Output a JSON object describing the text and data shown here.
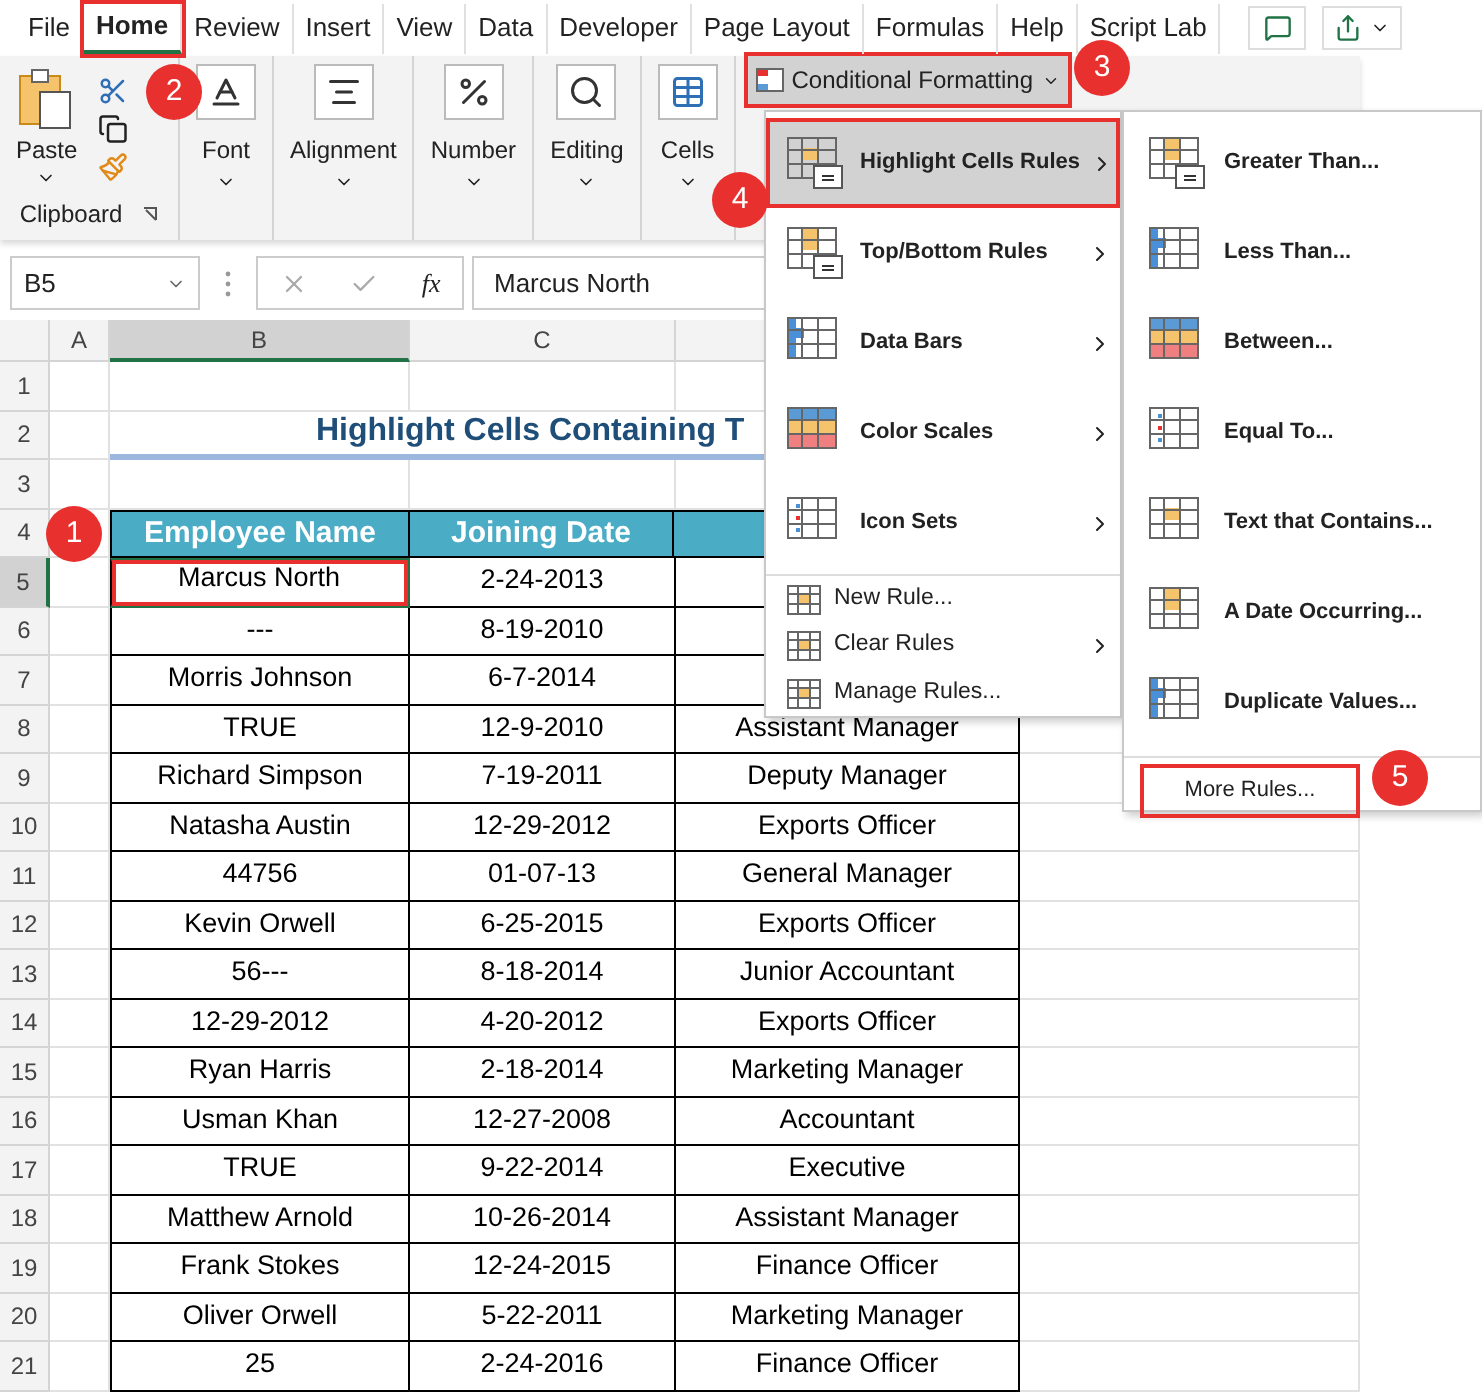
{
  "tabs": [
    {
      "label": "File",
      "selected": false,
      "outlined": false
    },
    {
      "label": "Home",
      "selected": true,
      "outlined": true
    },
    {
      "label": "Review",
      "selected": false,
      "outlined": false
    },
    {
      "label": "Insert",
      "selected": false,
      "outlined": false
    },
    {
      "label": "View",
      "selected": false,
      "outlined": false
    },
    {
      "label": "Data",
      "selected": false,
      "outlined": false
    },
    {
      "label": "Developer",
      "selected": false,
      "outlined": false
    },
    {
      "label": "Page Layout",
      "selected": false,
      "outlined": false
    },
    {
      "label": "Formulas",
      "selected": false,
      "outlined": false
    },
    {
      "label": "Help",
      "selected": false,
      "outlined": false
    },
    {
      "label": "Script Lab",
      "selected": false,
      "outlined": false
    }
  ],
  "ribbon": {
    "clipboard": {
      "paste": "Paste",
      "label": "Clipboard"
    },
    "groups": [
      {
        "label": "Font",
        "kind": "font"
      },
      {
        "label": "Alignment",
        "kind": "alignment"
      },
      {
        "label": "Number",
        "kind": "number"
      },
      {
        "label": "Editing",
        "kind": "editing"
      },
      {
        "label": "Cells",
        "kind": "cells"
      }
    ],
    "conditional_formatting": {
      "label": "Conditional Formatting",
      "outlined": true
    }
  },
  "formula_bar": {
    "name_box": "B5",
    "function_label": "fx",
    "value": "Marcus North"
  },
  "column_headers": [
    "A",
    "B",
    "C"
  ],
  "row_numbers": [
    "1",
    "2",
    "3",
    "4",
    "5",
    "6",
    "7",
    "8",
    "9",
    "10",
    "11",
    "12",
    "13",
    "14",
    "15",
    "16",
    "17",
    "18",
    "19",
    "20",
    "21"
  ],
  "title": "Highlight Cells Containing T",
  "table": {
    "columns": [
      "Employee Name",
      "Joining Date"
    ],
    "rows": [
      {
        "cells": [
          "Marcus North",
          "2-24-2013"
        ],
        "selected": true,
        "outlined": true
      },
      {
        "cells": [
          "---",
          "8-19-2010"
        ],
        "selected": false,
        "outlined": false
      },
      {
        "cells": [
          "Morris Johnson",
          "6-7-2014"
        ],
        "selected": false,
        "outlined": false
      },
      {
        "cells": [
          "TRUE",
          "12-9-2010",
          "Assistant Manager"
        ],
        "selected": false,
        "outlined": false
      },
      {
        "cells": [
          "Richard Simpson",
          "7-19-2011",
          "Deputy Manager"
        ],
        "selected": false,
        "outlined": false
      },
      {
        "cells": [
          "Natasha Austin",
          "12-29-2012",
          "Exports Officer"
        ],
        "selected": false,
        "outlined": false
      },
      {
        "cells": [
          "44756",
          "01-07-13",
          "General Manager"
        ],
        "selected": false,
        "outlined": false
      },
      {
        "cells": [
          "Kevin Orwell",
          "6-25-2015",
          "Exports Officer"
        ],
        "selected": false,
        "outlined": false
      },
      {
        "cells": [
          "56---",
          "8-18-2014",
          "Junior Accountant"
        ],
        "selected": false,
        "outlined": false
      },
      {
        "cells": [
          "12-29-2012",
          "4-20-2012",
          "Exports Officer"
        ],
        "selected": false,
        "outlined": false
      },
      {
        "cells": [
          "Ryan Harris",
          "2-18-2014",
          "Marketing Manager"
        ],
        "selected": false,
        "outlined": false
      },
      {
        "cells": [
          "Usman Khan",
          "12-27-2008",
          "Accountant"
        ],
        "selected": false,
        "outlined": false
      },
      {
        "cells": [
          "TRUE",
          "9-22-2014",
          "Executive"
        ],
        "selected": false,
        "outlined": false
      },
      {
        "cells": [
          "Matthew Arnold",
          "10-26-2014",
          "Assistant Manager"
        ],
        "selected": false,
        "outlined": false
      },
      {
        "cells": [
          "Frank Stokes",
          "12-24-2015",
          "Finance Officer"
        ],
        "selected": false,
        "outlined": false
      },
      {
        "cells": [
          "Oliver Orwell",
          "5-22-2011",
          "Marketing Manager"
        ],
        "selected": false,
        "outlined": false
      },
      {
        "cells": [
          "25",
          "2-24-2016",
          "Finance Officer"
        ],
        "selected": false,
        "outlined": false
      }
    ]
  },
  "menu": {
    "items": [
      {
        "label": "Highlight Cells Rules",
        "kind": "large",
        "submenu": true,
        "selected": true,
        "outlined": true
      },
      {
        "label": "Top/Bottom Rules",
        "kind": "large",
        "submenu": true,
        "selected": false,
        "outlined": false
      },
      {
        "label": "Data Bars",
        "kind": "large",
        "submenu": true,
        "selected": false,
        "outlined": false
      },
      {
        "label": "Color Scales",
        "kind": "large",
        "submenu": true,
        "selected": false,
        "outlined": false
      },
      {
        "label": "Icon Sets",
        "kind": "large",
        "submenu": true,
        "selected": false,
        "outlined": false
      },
      {
        "label": "New Rule...",
        "kind": "small",
        "submenu": false,
        "selected": false,
        "outlined": false
      },
      {
        "label": "Clear Rules",
        "kind": "small",
        "submenu": true,
        "selected": false,
        "outlined": false
      },
      {
        "label": "Manage Rules...",
        "kind": "small",
        "submenu": false,
        "selected": false,
        "outlined": false
      }
    ]
  },
  "submenu": {
    "items": [
      {
        "label": "Greater Than...",
        "kind": "large",
        "outlined": false
      },
      {
        "label": "Less Than...",
        "kind": "large",
        "outlined": false
      },
      {
        "label": "Between...",
        "kind": "large",
        "outlined": false
      },
      {
        "label": "Equal To...",
        "kind": "large",
        "outlined": false
      },
      {
        "label": "Text that Contains...",
        "kind": "large",
        "outlined": false
      },
      {
        "label": "A Date Occurring...",
        "kind": "large",
        "outlined": false
      },
      {
        "label": "Duplicate Values...",
        "kind": "large",
        "outlined": false
      },
      {
        "label": "More Rules...",
        "kind": "footer",
        "outlined": true
      }
    ]
  },
  "callouts": [
    "1",
    "2",
    "3",
    "4",
    "5"
  ]
}
